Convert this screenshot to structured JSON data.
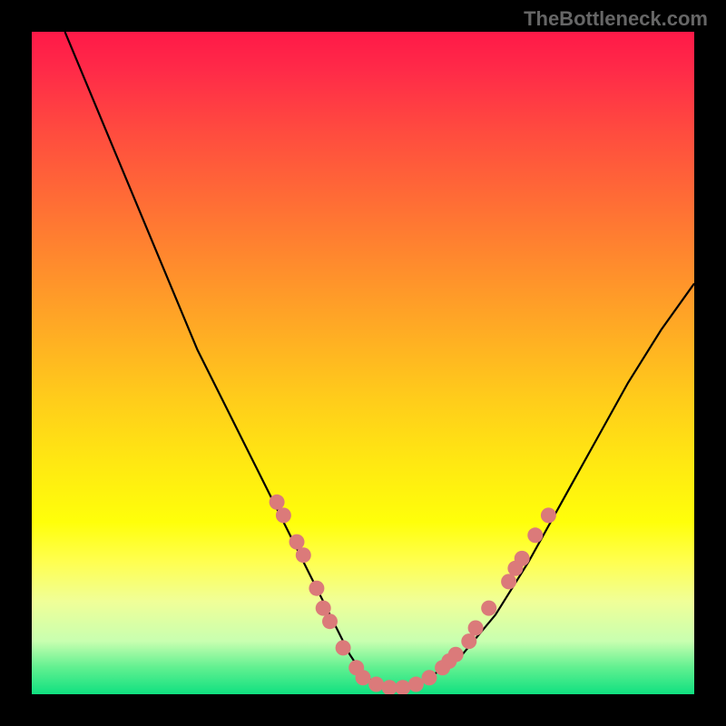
{
  "watermark": "TheBottleneck.com",
  "chart_data": {
    "type": "line",
    "title": "",
    "xlabel": "",
    "ylabel": "",
    "xlim": [
      0,
      100
    ],
    "ylim": [
      0,
      100
    ],
    "grid": false,
    "series": [
      {
        "name": "bottleneck-curve",
        "x": [
          5,
          10,
          15,
          20,
          25,
          30,
          32,
          34,
          36,
          38,
          40,
          42,
          44,
          46,
          48,
          50,
          52,
          54,
          56,
          58,
          60,
          65,
          70,
          75,
          80,
          85,
          90,
          95,
          100
        ],
        "y": [
          100,
          88,
          76,
          64,
          52,
          42,
          38,
          34,
          30,
          26,
          22,
          18,
          14,
          10,
          6,
          3,
          1.5,
          1,
          1,
          1.5,
          2.5,
          6,
          12,
          20,
          29,
          38,
          47,
          55,
          62
        ],
        "color": "#000000"
      }
    ],
    "markers": [
      {
        "x": 37,
        "y": 29,
        "color": "#db7a7a"
      },
      {
        "x": 38,
        "y": 27,
        "color": "#db7a7a"
      },
      {
        "x": 40,
        "y": 23,
        "color": "#db7a7a"
      },
      {
        "x": 41,
        "y": 21,
        "color": "#db7a7a"
      },
      {
        "x": 43,
        "y": 16,
        "color": "#db7a7a"
      },
      {
        "x": 44,
        "y": 13,
        "color": "#db7a7a"
      },
      {
        "x": 45,
        "y": 11,
        "color": "#db7a7a"
      },
      {
        "x": 47,
        "y": 7,
        "color": "#db7a7a"
      },
      {
        "x": 49,
        "y": 4,
        "color": "#db7a7a"
      },
      {
        "x": 50,
        "y": 2.5,
        "color": "#db7a7a"
      },
      {
        "x": 52,
        "y": 1.5,
        "color": "#db7a7a"
      },
      {
        "x": 54,
        "y": 1,
        "color": "#db7a7a"
      },
      {
        "x": 56,
        "y": 1,
        "color": "#db7a7a"
      },
      {
        "x": 58,
        "y": 1.5,
        "color": "#db7a7a"
      },
      {
        "x": 60,
        "y": 2.5,
        "color": "#db7a7a"
      },
      {
        "x": 62,
        "y": 4,
        "color": "#db7a7a"
      },
      {
        "x": 63,
        "y": 5,
        "color": "#db7a7a"
      },
      {
        "x": 64,
        "y": 6,
        "color": "#db7a7a"
      },
      {
        "x": 66,
        "y": 8,
        "color": "#db7a7a"
      },
      {
        "x": 67,
        "y": 10,
        "color": "#db7a7a"
      },
      {
        "x": 69,
        "y": 13,
        "color": "#db7a7a"
      },
      {
        "x": 72,
        "y": 17,
        "color": "#db7a7a"
      },
      {
        "x": 73,
        "y": 19,
        "color": "#db7a7a"
      },
      {
        "x": 74,
        "y": 20.5,
        "color": "#db7a7a"
      },
      {
        "x": 76,
        "y": 24,
        "color": "#db7a7a"
      },
      {
        "x": 78,
        "y": 27,
        "color": "#db7a7a"
      }
    ],
    "marker_radius": 8.5
  }
}
